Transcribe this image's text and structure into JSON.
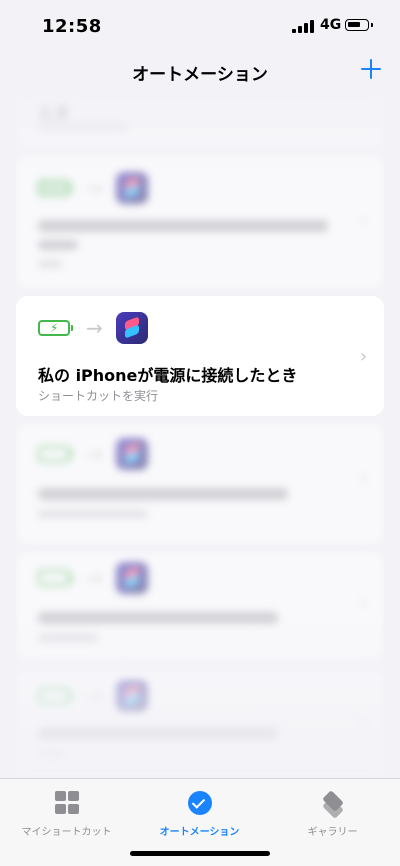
{
  "status": {
    "time": "12:58",
    "network": "4G"
  },
  "nav": {
    "title": "オートメーション"
  },
  "list": {
    "top_partial_title": "とき",
    "focused": {
      "title": "私の iPhoneが電源に接続したとき",
      "subtitle": "ショートカットを実行"
    }
  },
  "tabs": [
    {
      "label": "マイショートカット",
      "icon": "grid-icon"
    },
    {
      "label": "オートメーション",
      "icon": "check-circle-icon",
      "active": true
    },
    {
      "label": "ギャラリー",
      "icon": "layers-icon"
    }
  ],
  "colors": {
    "accent": "#1a84ff",
    "battery_green": "#44b84a",
    "background": "#f2f2f7"
  }
}
